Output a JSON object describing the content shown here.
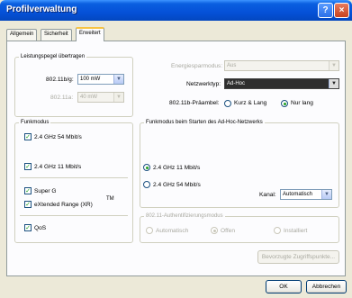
{
  "window": {
    "title": "Profilverwaltung",
    "help_glyph": "?",
    "close_glyph": "×"
  },
  "tabs": [
    {
      "label": "Allgemein"
    },
    {
      "label": "Sicherheit"
    },
    {
      "label": "Erweitert"
    }
  ],
  "power": {
    "legend": "Leistungspegel übertragen",
    "b_label": "802.11b/g:",
    "b_value": "100 mW",
    "a_label": "802.11a:",
    "a_value": "40 mW"
  },
  "energy": {
    "label": "Energiesparmodus:",
    "value": "Aus"
  },
  "network_type": {
    "label": "Netzwerktyp:",
    "value": "Ad-Hoc"
  },
  "preamble": {
    "label": "802.11b-Präambel:",
    "short_label": "Kurz & Lang",
    "long_label": "Nur lang",
    "selected": "long"
  },
  "wireless_mode": {
    "legend": "Funkmodus",
    "opt1": "2.4 GHz 54 Mbit/s",
    "opt2": "2.4 GHz 11 Mbit/s",
    "super_g": "Super G",
    "xr": "eXtended Range (XR)",
    "tm": "TM",
    "qos": "QoS",
    "check_glyph": "✓"
  },
  "adhoc": {
    "legend": "Funkmodus beim Starten des Ad-Hoc-Netzwerks",
    "opt1": "2.4 GHz 11 Mbit/s",
    "opt2": "2.4 GHz 54 Mbit/s",
    "selected": "opt1",
    "channel_label": "Kanal:",
    "channel_value": "Automatisch"
  },
  "auth": {
    "legend": "802.11-Authentifizierungsmodus",
    "auto": "Automatisch",
    "open": "Offen",
    "shared": "Installiert",
    "selected": "open"
  },
  "preferred_ap_button": "Bevorzugte Zugriffspunkte...",
  "ok_button": "OK",
  "cancel_button": "Abbrechen",
  "dropdown_glyph": "▼"
}
